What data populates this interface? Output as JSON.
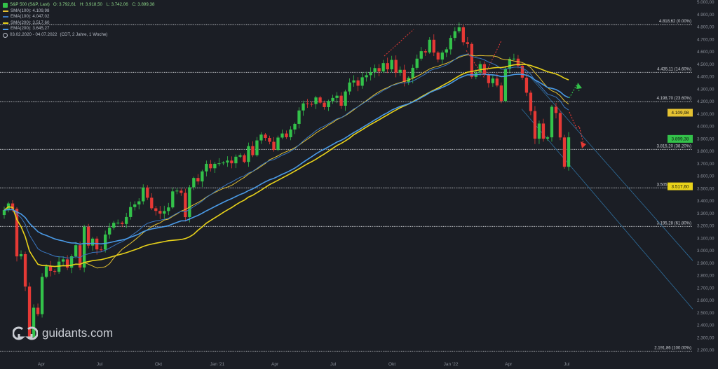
{
  "header": {
    "instrument": "S&P 500 (S&P, Last)",
    "ohlc": [
      "O: 3.792,61",
      "H: 3.918,50",
      "L: 3.742,06",
      "C: 3.899,38"
    ],
    "indicators": [
      {
        "name": "SMA(100)",
        "value": "4.109,98",
        "color": "#e5c232"
      },
      {
        "name": "EMA(100)",
        "value": "4.047,02",
        "color": "#3a78c2"
      },
      {
        "name": "SMA(200)",
        "value": "3.517,60",
        "color": "#e8d21a"
      },
      {
        "name": "EMA(200)",
        "value": "3.645,27",
        "color": "#4a9ae6"
      }
    ],
    "period": "03.02.2020 - 04.07.2022",
    "period_note": "(CDT, 2 Jahre, 1 Woche)"
  },
  "colors": {
    "up": "#33c24a",
    "down": "#e53935",
    "price_marker": "#d9c21a"
  },
  "logo": {
    "text": "guidants.com"
  },
  "chart_data": {
    "type": "candlestick",
    "title": "S&P 500 (S&P, Last)",
    "ylim": [
      2200,
      5000
    ],
    "x_range": [
      "2020-02-03",
      "2022-07-04"
    ],
    "y_ticks": [
      "5.000,00",
      "4.900,00",
      "4.800,00",
      "4.700,00",
      "4.600,00",
      "4.500,00",
      "4.400,00",
      "4.300,00",
      "4.200,00",
      "4.100,00",
      "4.000,00",
      "3.900,00",
      "3.800,00",
      "3.700,00",
      "3.600,00",
      "3.500,00",
      "3.400,00",
      "3.300,00",
      "3.200,00",
      "3.100,00",
      "3.000,00",
      "2.900,00",
      "2.800,00",
      "2.700,00",
      "2.600,00",
      "2.500,00",
      "2.400,00",
      "2.300,00",
      "2.200,00"
    ],
    "x_ticks": [
      {
        "label": "Apr",
        "date": "2020-04-01"
      },
      {
        "label": "Jul",
        "date": "2020-07-01"
      },
      {
        "label": "Okt",
        "date": "2020-10-01"
      },
      {
        "label": "Jan '21",
        "date": "2021-01-01"
      },
      {
        "label": "Apr",
        "date": "2021-04-01"
      },
      {
        "label": "Jul",
        "date": "2021-07-01"
      },
      {
        "label": "Okt",
        "date": "2021-10-01"
      },
      {
        "label": "Jan '22",
        "date": "2022-01-01"
      },
      {
        "label": "Apr",
        "date": "2022-04-01"
      },
      {
        "label": "Jul",
        "date": "2022-07-01"
      }
    ],
    "fib_levels": [
      {
        "value": 4818.62,
        "label": "4.818,62 (0.00%)"
      },
      {
        "value": 4435.11,
        "label": "4.435,11 (14.60%)"
      },
      {
        "value": 4198.7,
        "label": "4.198,70 (23.60%)"
      },
      {
        "value": 3815.2,
        "label": "3.815,20 (38.20%)"
      },
      {
        "value": 3505.24,
        "label": "3.505,24 (50.00%)"
      },
      {
        "value": 3195.28,
        "label": "3.195,28 (61.80%)"
      },
      {
        "value": 2191.86,
        "label": "2.191,86 (100.00%)"
      }
    ],
    "price_tags": [
      {
        "value": 4109.98,
        "label": "4.109,98",
        "color": "#e5c232"
      },
      {
        "value": 3899.38,
        "label": "3.899,38",
        "color": "#33c24a"
      },
      {
        "value": 3517.6,
        "label": "3.517,60",
        "color": "#e8d21a"
      }
    ],
    "weekly_close": [
      3327,
      3380,
      3337,
      2954,
      2972,
      2711,
      2305,
      2541,
      2489,
      2789,
      2874,
      2837,
      2830,
      2912,
      2930,
      2863,
      2955,
      3044,
      2864,
      3193,
      3041,
      3097,
      3010,
      3009,
      3130,
      3185,
      3224,
      3225,
      3215,
      3271,
      3351,
      3372,
      3397,
      3508,
      3426,
      3341,
      3320,
      3298,
      3319,
      3348,
      3477,
      3483,
      3465,
      3270,
      3510,
      3585,
      3557,
      3638,
      3699,
      3663,
      3699,
      3703,
      3709,
      3725,
      3703,
      3756,
      3768,
      3714,
      3841,
      3768,
      3887,
      3934,
      3907,
      3876,
      3811,
      3910,
      3943,
      3913,
      3975,
      4020,
      4128,
      4185,
      4181,
      4180,
      4233,
      4191,
      4155,
      4204,
      4229,
      4247,
      4166,
      4281,
      4353,
      4370,
      4327,
      4395,
      4412,
      4437,
      4469,
      4442,
      4509,
      4459,
      4535,
      4432,
      4455,
      4357,
      4391,
      4471,
      4545,
      4605,
      4595,
      4697,
      4594,
      4538,
      4594,
      4620,
      4712,
      4766,
      4797,
      4677,
      4663,
      4398,
      4432,
      4501,
      4418,
      4348,
      4385,
      4329,
      4204,
      4463,
      4543,
      4545,
      4488,
      4392,
      4271,
      4123,
      3901,
      4023,
      3901,
      3912,
      4158,
      4108,
      3911,
      3675,
      3912
    ],
    "indicator_lines": [
      {
        "name": "SMA(100)",
        "color": "#e5c232",
        "last": 4109.98
      },
      {
        "name": "EMA(100)",
        "color": "#3a78c2",
        "last": 4047.02
      },
      {
        "name": "SMA(200)",
        "color": "#e8d21a",
        "last": 3517.6
      },
      {
        "name": "EMA(200)",
        "color": "#4a9ae6",
        "last": 3645.27
      }
    ]
  }
}
